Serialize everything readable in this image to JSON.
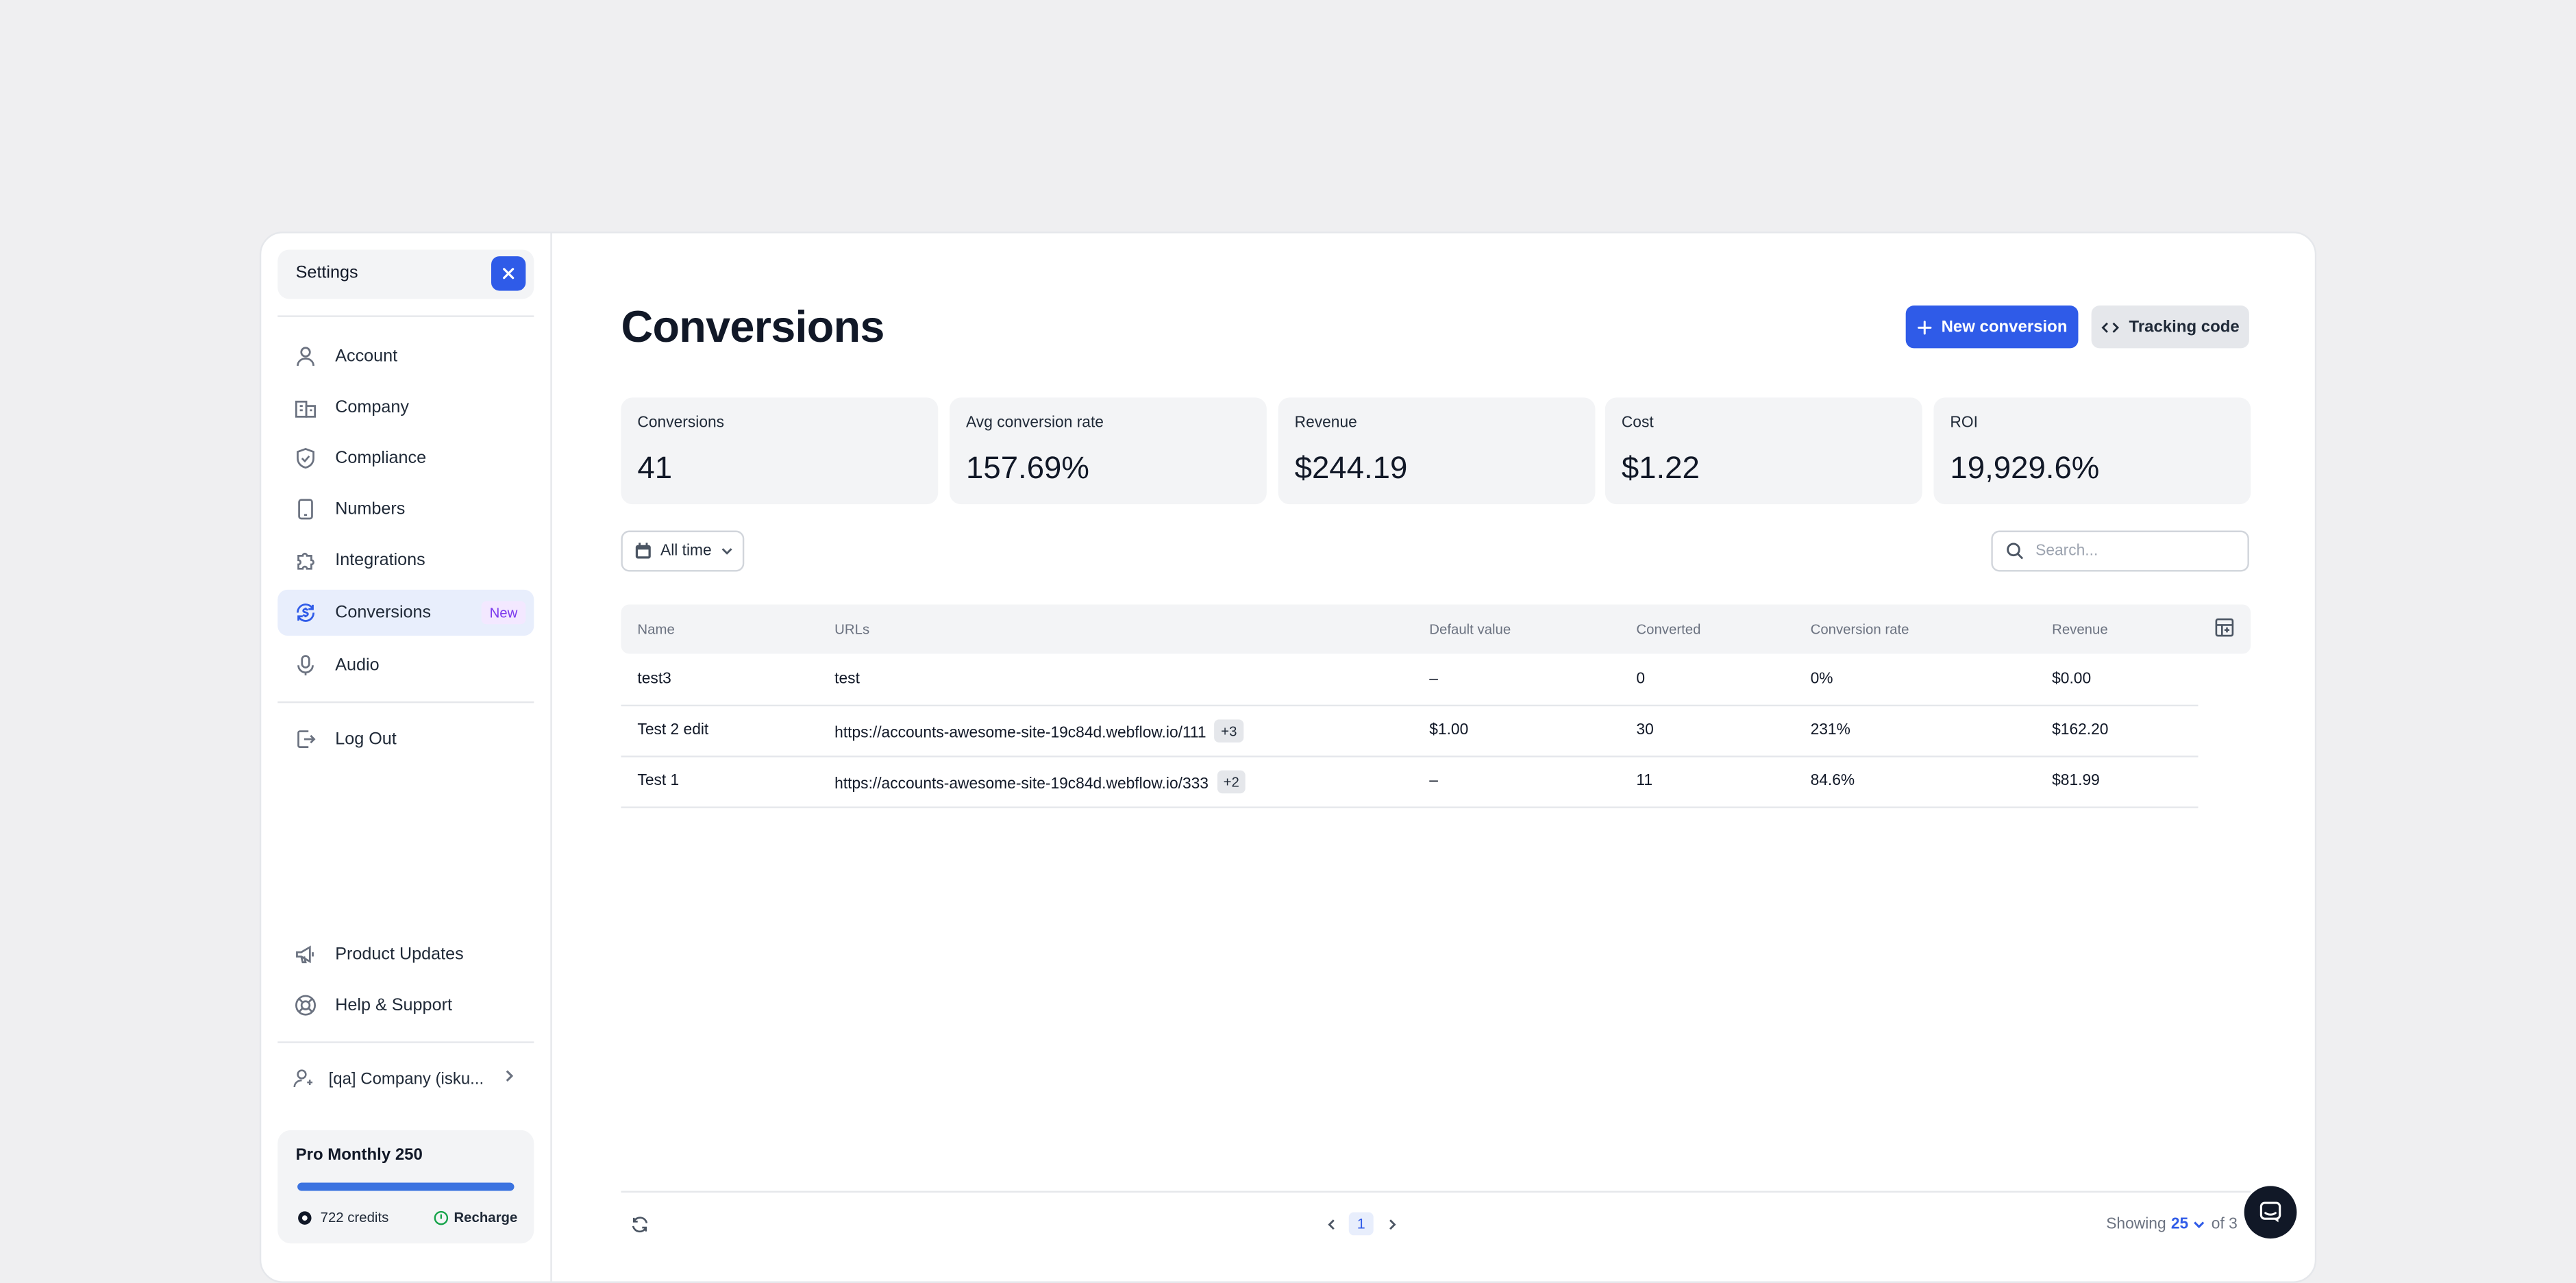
{
  "sidebar": {
    "settings_label": "Settings",
    "items": [
      {
        "label": "Account",
        "icon": "user-icon"
      },
      {
        "label": "Company",
        "icon": "building-icon"
      },
      {
        "label": "Compliance",
        "icon": "shield-check-icon"
      },
      {
        "label": "Numbers",
        "icon": "phone-device-icon"
      },
      {
        "label": "Integrations",
        "icon": "puzzle-icon"
      },
      {
        "label": "Conversions",
        "icon": "conversion-dollar-icon",
        "badge": "New"
      },
      {
        "label": "Audio",
        "icon": "microphone-icon"
      }
    ],
    "logout_label": "Log Out",
    "bottom_items": [
      {
        "label": "Product Updates",
        "icon": "megaphone-icon"
      },
      {
        "label": "Help & Support",
        "icon": "lifebuoy-icon"
      }
    ],
    "company_label": "[qa] Company (isku...",
    "plan": {
      "title": "Pro Monthly 250",
      "usage_fraction": 1.0,
      "credits_label": "722 credits",
      "recharge_label": "Recharge"
    }
  },
  "main": {
    "title": "Conversions",
    "new_button": "New conversion",
    "tracking_button": "Tracking code",
    "stats": [
      {
        "label": "Conversions",
        "value": "41"
      },
      {
        "label": "Avg conversion rate",
        "value": "157.69%"
      },
      {
        "label": "Revenue",
        "value": "$244.19"
      },
      {
        "label": "Cost",
        "value": "$1.22"
      },
      {
        "label": "ROI",
        "value": "19,929.6%"
      }
    ],
    "filter_label": "All time",
    "search_placeholder": "Search...",
    "table": {
      "columns": [
        "Name",
        "URLs",
        "Default value",
        "Converted",
        "Conversion rate",
        "Revenue"
      ],
      "rows": [
        {
          "name": "test3",
          "url": "test",
          "extra": "",
          "default_value": "–",
          "converted": "0",
          "rate": "0%",
          "revenue": "$0.00"
        },
        {
          "name": "Test 2 edit",
          "url": "https://accounts-awesome-site-19c84d.webflow.io/111",
          "extra": "+3",
          "default_value": "$1.00",
          "converted": "30",
          "rate": "231%",
          "revenue": "$162.20"
        },
        {
          "name": "Test 1",
          "url": "https://accounts-awesome-site-19c84d.webflow.io/333",
          "extra": "+2",
          "default_value": "–",
          "converted": "11",
          "rate": "84.6%",
          "revenue": "$81.99"
        }
      ]
    },
    "pagination": {
      "current_page": "1",
      "showing_label": "Showing",
      "per_page": "25",
      "of_label": "of 3"
    }
  },
  "colors": {
    "accent": "#2f5be8",
    "background": "#efeff1",
    "badge_text": "#7c3aed"
  }
}
